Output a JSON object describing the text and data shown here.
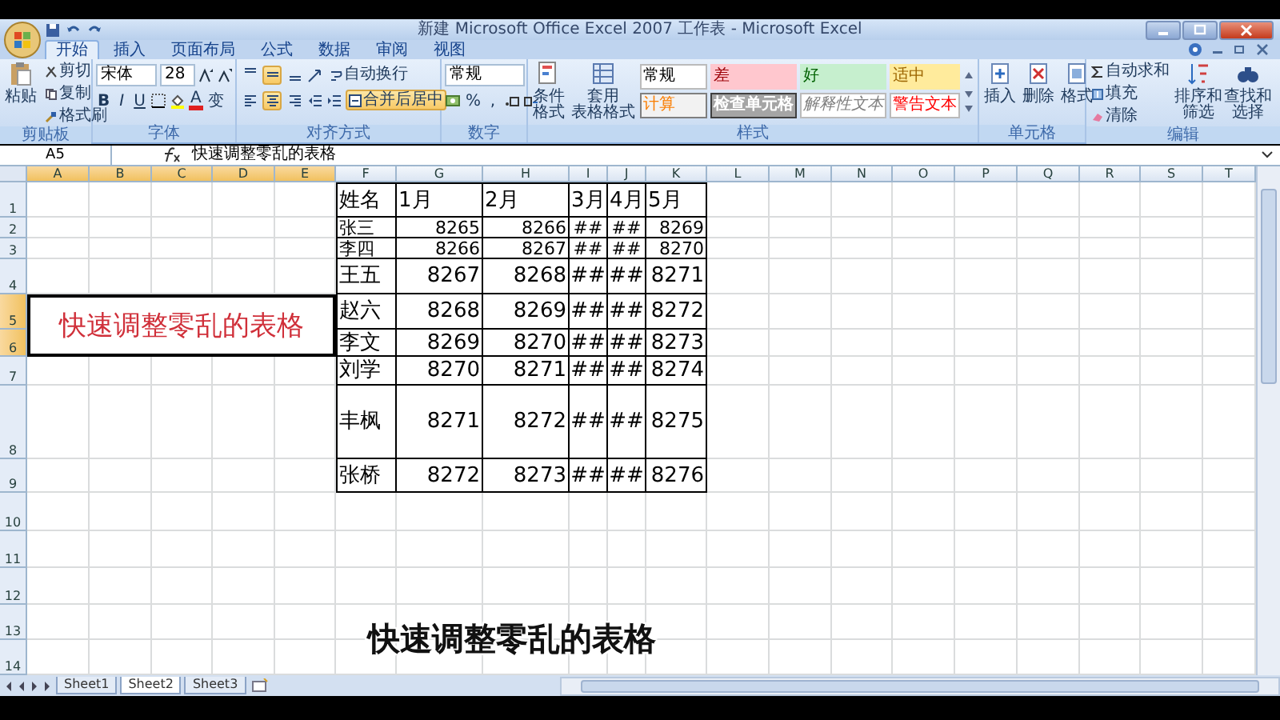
{
  "window": {
    "title": "新建 Microsoft Office Excel 2007 工作表 - Microsoft Excel"
  },
  "tabs": [
    {
      "label": "开始",
      "selected": true
    },
    {
      "label": "插入",
      "selected": false
    },
    {
      "label": "页面布局",
      "selected": false
    },
    {
      "label": "公式",
      "selected": false
    },
    {
      "label": "数据",
      "selected": false
    },
    {
      "label": "审阅",
      "selected": false
    },
    {
      "label": "视图",
      "selected": false
    }
  ],
  "ribbon": {
    "clipboard": {
      "label": "剪贴板",
      "paste": "粘贴",
      "items": [
        "剪切",
        "复制",
        "格式刷"
      ]
    },
    "font": {
      "label": "字体",
      "font_name": "宋体",
      "font_size": "28",
      "styles": [
        "B",
        "I",
        "U"
      ],
      "color_letter": "A",
      "phonetic": "变"
    },
    "alignment": {
      "label": "对齐方式",
      "vertical": [
        {
          "selected": false
        },
        {
          "selected": true
        },
        {
          "selected": false
        }
      ],
      "horizontal": [
        {
          "selected": false
        },
        {
          "selected": true
        },
        {
          "selected": false
        }
      ],
      "wrap": {
        "label": "自动换行",
        "on": false
      },
      "merge": {
        "label": "合并后居中",
        "on": true
      }
    },
    "number": {
      "label": "数字",
      "format": "常规",
      "percent": "%",
      "comma": ","
    },
    "styles": {
      "label": "样式",
      "conditional": "条件格式",
      "table_format": [
        "套用",
        "表格格式"
      ],
      "cell_styles": [
        {
          "label": "常规",
          "kind": "normal"
        },
        {
          "label": "差",
          "kind": "bad"
        },
        {
          "label": "好",
          "kind": "good"
        },
        {
          "label": "适中",
          "kind": "neutral"
        },
        {
          "label": "计算",
          "kind": "calculation"
        },
        {
          "label": "检查单元格",
          "kind": "check"
        },
        {
          "label": "解释性文本",
          "kind": "explanatory"
        },
        {
          "label": "警告文本",
          "kind": "warning"
        }
      ]
    },
    "cells": {
      "label": "单元格",
      "items": [
        "插入",
        "删除",
        "格式"
      ]
    },
    "editing": {
      "label": "编辑",
      "items": [
        "自动求和",
        "填充",
        "清除"
      ],
      "sort": [
        "排序和",
        "筛选"
      ],
      "find": [
        "查找和",
        "选择"
      ]
    }
  },
  "formula_bar": {
    "name_box": "A5",
    "formula": "快速调整零乱的表格"
  },
  "sheet": {
    "columns": [
      {
        "label": "A",
        "selected": true
      },
      {
        "label": "B",
        "selected": true
      },
      {
        "label": "C",
        "selected": true
      },
      {
        "label": "D",
        "selected": true
      },
      {
        "label": "E",
        "selected": true
      },
      {
        "label": "F",
        "selected": false
      },
      {
        "label": "G",
        "selected": false
      },
      {
        "label": "H",
        "selected": false
      },
      {
        "label": "I",
        "selected": false
      },
      {
        "label": "J",
        "selected": false
      },
      {
        "label": "K",
        "selected": false
      },
      {
        "label": "L",
        "selected": false
      },
      {
        "label": "M",
        "selected": false
      },
      {
        "label": "N",
        "selected": false
      },
      {
        "label": "O",
        "selected": false
      },
      {
        "label": "P",
        "selected": false
      },
      {
        "label": "Q",
        "selected": false
      },
      {
        "label": "R",
        "selected": false
      },
      {
        "label": "S",
        "selected": false
      },
      {
        "label": "T",
        "selected": false
      }
    ],
    "row_numbers": [
      {
        "label": "1",
        "selected": false
      },
      {
        "label": "2",
        "selected": false
      },
      {
        "label": "3",
        "selected": false
      },
      {
        "label": "4",
        "selected": false
      },
      {
        "label": "5",
        "selected": true
      },
      {
        "label": "6",
        "selected": true
      },
      {
        "label": "7",
        "selected": false
      },
      {
        "label": "8",
        "selected": false
      },
      {
        "label": "9",
        "selected": false
      },
      {
        "label": "10",
        "selected": false
      },
      {
        "label": "11",
        "selected": false
      },
      {
        "label": "12",
        "selected": false
      },
      {
        "label": "13",
        "selected": false
      },
      {
        "label": "14",
        "selected": false
      }
    ],
    "merged_cell": {
      "text": "快速调整零乱的表格"
    },
    "table": [
      [
        "姓名",
        "1月",
        "2月",
        "3月",
        "4月",
        "5月"
      ],
      [
        "张三",
        "8265",
        "8266",
        "##",
        "##",
        "8269"
      ],
      [
        "李四",
        "8266",
        "8267",
        "##",
        "##",
        "8270"
      ],
      [
        "王五",
        "8267",
        "8268",
        "##",
        "##",
        "8271"
      ],
      [
        "赵六",
        "8268",
        "8269",
        "##",
        "##",
        "8272"
      ],
      [
        "李文",
        "8269",
        "8270",
        "##",
        "##",
        "8273"
      ],
      [
        "刘学",
        "8270",
        "8271",
        "##",
        "##",
        "8274"
      ],
      [
        "丰枫",
        "8271",
        "8272",
        "##",
        "##",
        "8275"
      ],
      [
        "张桥",
        "8272",
        "8273",
        "##",
        "##",
        "8276"
      ]
    ]
  },
  "sheet_tabs": [
    {
      "label": "Sheet1",
      "selected": false
    },
    {
      "label": "Sheet2",
      "selected": true
    },
    {
      "label": "Sheet3",
      "selected": false
    }
  ],
  "subtitle": "快速调整零乱的表格"
}
